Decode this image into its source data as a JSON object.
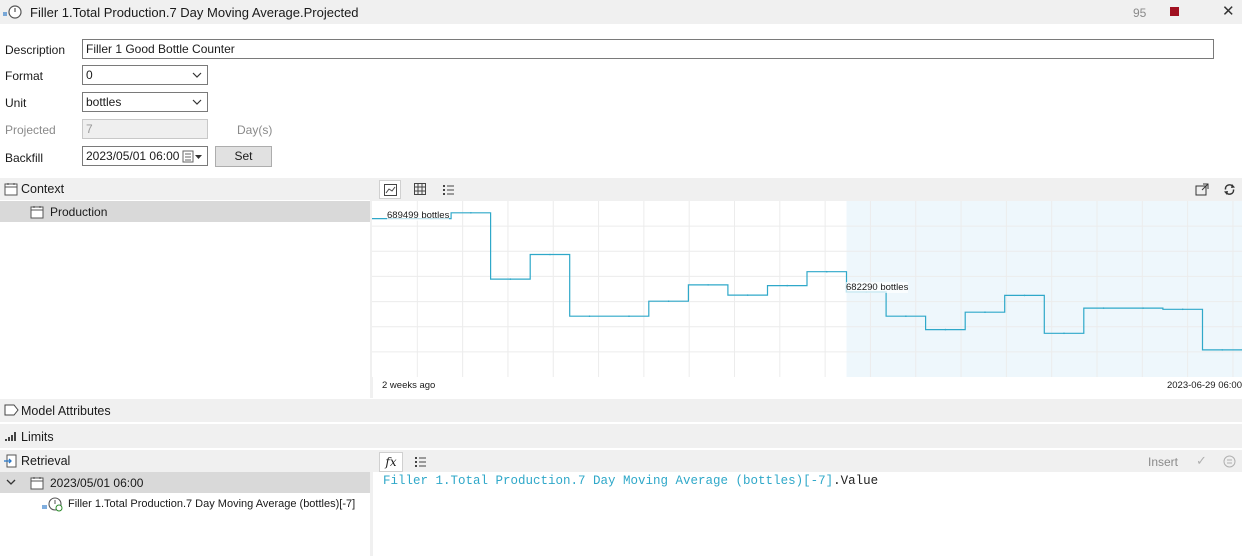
{
  "window": {
    "title": "Filler 1.Total Production.7 Day Moving Average.Projected",
    "count": "95"
  },
  "form": {
    "description_label": "Description",
    "description_value": "Filler 1 Good Bottle Counter",
    "format_label": "Format",
    "format_value": "0",
    "unit_label": "Unit",
    "unit_value": "bottles",
    "projected_label": "Projected",
    "projected_value": "7",
    "projected_unit": "Day(s)",
    "backfill_label": "Backfill",
    "backfill_value": "2023/05/01 06:00",
    "set_label": "Set"
  },
  "context": {
    "header": "Context",
    "items": [
      "Production"
    ]
  },
  "chart": {
    "start_label": "2 weeks ago",
    "end_label": "2023-06-29 06:00",
    "annotations": [
      "689499 bottles",
      "682290 bottles"
    ]
  },
  "chart_data": {
    "type": "line",
    "step": true,
    "series": [
      {
        "unit": "bottles",
        "values": [
          689499,
          689499,
          689930,
          685030,
          686850,
          682290,
          682290,
          683400,
          684600,
          683850,
          684550,
          685580,
          684080,
          682290,
          681300,
          682590,
          683830,
          681030,
          682890,
          682890,
          682800,
          679800
        ]
      }
    ],
    "projected_from_index": 12
  },
  "sections": {
    "model_attributes": "Model Attributes",
    "limits": "Limits",
    "retrieval": "Retrieval"
  },
  "retrieval": {
    "node_time": "2023/05/01 06:00",
    "node_item": "Filler 1.Total Production.7 Day Moving Average (bottles)[-7]",
    "insert_label": "Insert",
    "expr_ref": "Filler 1.Total Production.7 Day Moving Average (bottles)[-7]",
    "expr_tail": ".Value"
  },
  "colors": {
    "line": "#2fa8c9",
    "projected_bg": "#eef7fc",
    "selection": "#d9d9d9",
    "expr_ref": "#2fa8c9"
  }
}
